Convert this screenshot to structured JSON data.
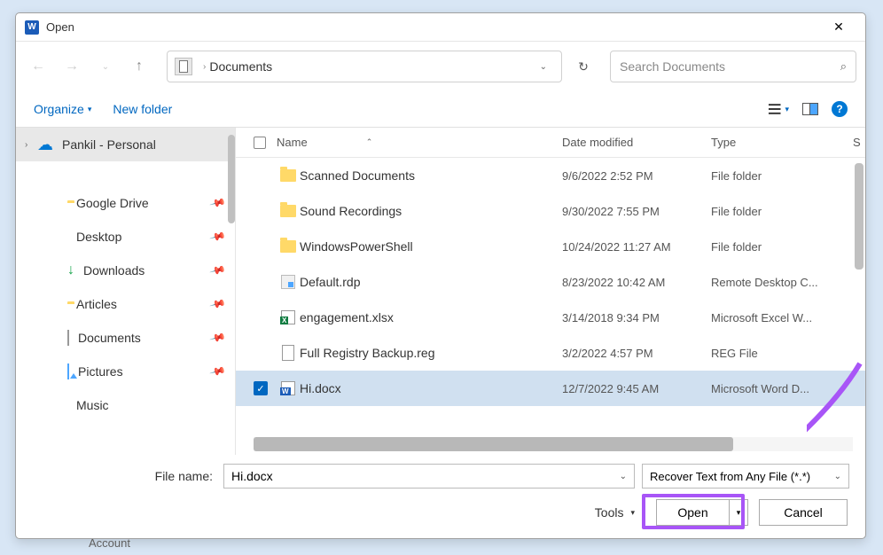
{
  "titlebar": {
    "title": "Open"
  },
  "nav": {
    "breadcrumb": "Documents",
    "search_placeholder": "Search Documents"
  },
  "toolbar": {
    "organize": "Organize",
    "newfolder": "New folder"
  },
  "sidebar": {
    "items": [
      {
        "label": "Pankil - Personal",
        "icon": "onedrive",
        "selected": true,
        "chevron": true
      },
      {
        "label": "Google Drive",
        "icon": "folder",
        "pinned": true,
        "indent": true
      },
      {
        "label": "Desktop",
        "icon": "desktop",
        "pinned": true,
        "indent": true
      },
      {
        "label": "Downloads",
        "icon": "download",
        "pinned": true,
        "indent": true
      },
      {
        "label": "Articles",
        "icon": "folder",
        "pinned": true,
        "indent": true
      },
      {
        "label": "Documents",
        "icon": "doc",
        "pinned": true,
        "indent": true
      },
      {
        "label": "Pictures",
        "icon": "pic",
        "pinned": true,
        "indent": true
      },
      {
        "label": "Music",
        "icon": "music",
        "pinned": false,
        "indent": true
      }
    ]
  },
  "columns": {
    "name": "Name",
    "date": "Date modified",
    "type": "Type",
    "extra": "S"
  },
  "files": [
    {
      "name": "Scanned Documents",
      "date": "9/6/2022 2:52 PM",
      "type": "File folder",
      "icon": "folder"
    },
    {
      "name": "Sound Recordings",
      "date": "9/30/2022 7:55 PM",
      "type": "File folder",
      "icon": "folder"
    },
    {
      "name": "WindowsPowerShell",
      "date": "10/24/2022 11:27 AM",
      "type": "File folder",
      "icon": "folder"
    },
    {
      "name": "Default.rdp",
      "date": "8/23/2022 10:42 AM",
      "type": "Remote Desktop C...",
      "icon": "rdp"
    },
    {
      "name": "engagement.xlsx",
      "date": "3/14/2018 9:34 PM",
      "type": "Microsoft Excel W...",
      "icon": "xlsx"
    },
    {
      "name": "Full Registry Backup.reg",
      "date": "3/2/2022 4:57 PM",
      "type": "REG File",
      "icon": "reg"
    },
    {
      "name": "Hi.docx",
      "date": "12/7/2022 9:45 AM",
      "type": "Microsoft Word D...",
      "icon": "docx",
      "selected": true
    }
  ],
  "bottom": {
    "filename_label": "File name:",
    "filename_value": "Hi.docx",
    "filter": "Recover Text from Any File (*.*)",
    "tools": "Tools",
    "open": "Open",
    "cancel": "Cancel"
  },
  "background": {
    "account": "Account"
  }
}
